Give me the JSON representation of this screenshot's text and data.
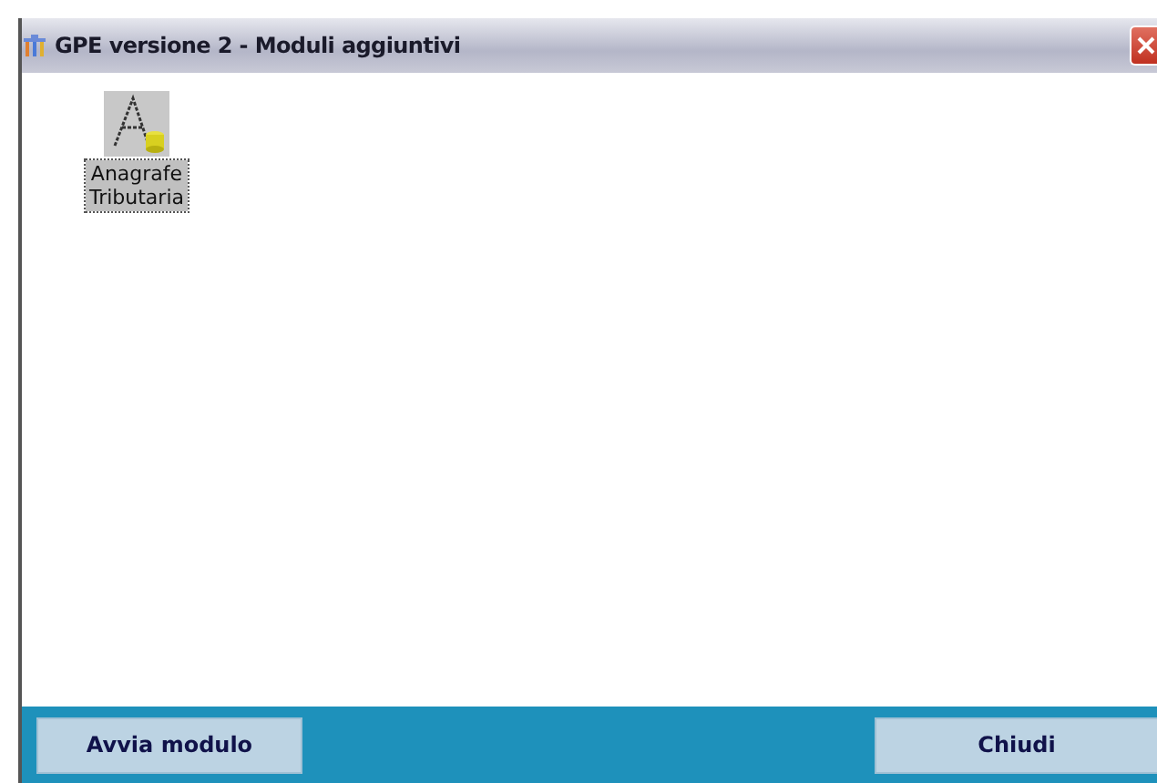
{
  "window": {
    "title": "GPE versione 2 - Moduli aggiuntivi"
  },
  "modules": [
    {
      "label": "Anagrafe\nTributaria",
      "selected": true
    }
  ],
  "buttons": [
    "Avvia modulo",
    "Chiudi"
  ]
}
